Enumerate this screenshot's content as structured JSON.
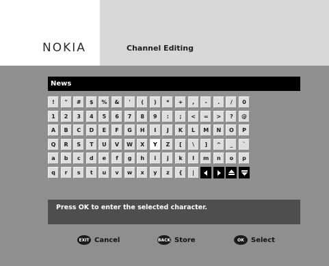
{
  "header": {
    "brand": "NOKIA",
    "title": "Channel Editing"
  },
  "input": {
    "value": "News"
  },
  "keyboard": {
    "rows": [
      [
        "!",
        "\"",
        "#",
        "$",
        "%",
        "&",
        "'",
        "(",
        ")",
        "*",
        "+",
        ",",
        "-",
        ".",
        "/",
        "0"
      ],
      [
        "1",
        "2",
        "3",
        "4",
        "5",
        "6",
        "7",
        "8",
        "9",
        ":",
        ";",
        "<",
        "=",
        ">",
        "?",
        "@"
      ],
      [
        "A",
        "B",
        "C",
        "D",
        "E",
        "F",
        "G",
        "H",
        "I",
        "J",
        "K",
        "L",
        "M",
        "N",
        "O",
        "P"
      ],
      [
        "Q",
        "R",
        "S",
        "T",
        "U",
        "V",
        "W",
        "X",
        "Y",
        "Z",
        "[",
        "\\",
        "]",
        "^",
        "_",
        "`"
      ],
      [
        "a",
        "b",
        "c",
        "d",
        "e",
        "f",
        "g",
        "h",
        "i",
        "j",
        "k",
        "l",
        "m",
        "n",
        "o",
        "p"
      ],
      [
        "q",
        "r",
        "s",
        "t",
        "u",
        "v",
        "w",
        "x",
        "y",
        "z",
        "{",
        "|",
        "◀",
        "▶",
        "▲",
        "▼"
      ]
    ],
    "selected": "Y",
    "nav_icons": [
      "arrow-left-icon",
      "arrow-right-icon",
      "shift-up-icon",
      "shift-down-icon"
    ]
  },
  "message": "Press OK to enter the selected character.",
  "footer": {
    "exit": {
      "icon_text": "EXIT",
      "label": "Cancel"
    },
    "back": {
      "icon_text": "BACK",
      "label": "Store"
    },
    "ok": {
      "icon_text": "OK",
      "label": "Select"
    }
  }
}
